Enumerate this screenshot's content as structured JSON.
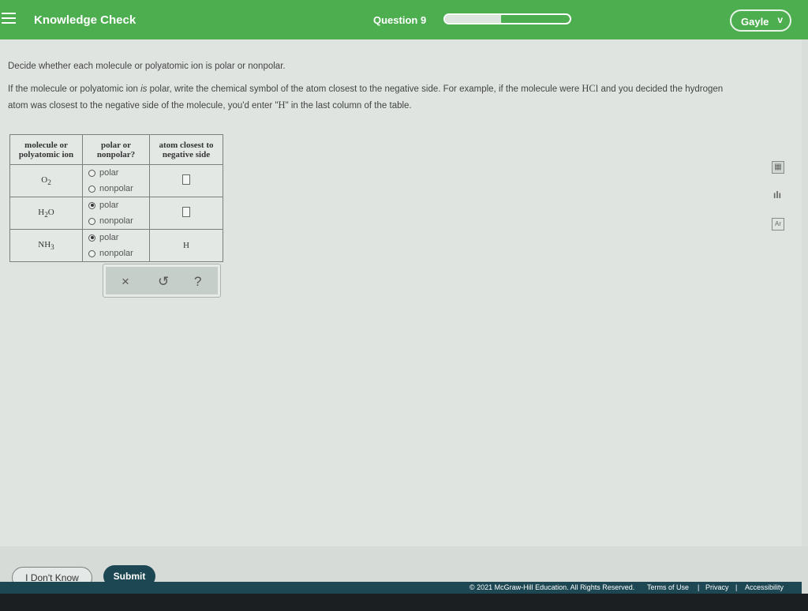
{
  "header": {
    "app_title": "Knowledge Check",
    "question_label": "Question 9",
    "progress_fraction": 0.45,
    "user_name": "Gayle",
    "user_chevron": "v"
  },
  "instructions": {
    "line1": "Decide whether each molecule or polyatomic ion is polar or nonpolar.",
    "line2_part1": "If the molecule or polyatomic ion ",
    "line2_is": "is",
    "line2_part2": " polar, write the chemical symbol of the atom closest to the negative side. For example, if the molecule were ",
    "example_molecule": "HCl",
    "line2_part3": " and you decided the hydrogen atom was closest to the negative side of the molecule, you'd enter \"",
    "example_answer": "H",
    "line2_part4": "\" in the last column of the table."
  },
  "table": {
    "headers": {
      "col1_line1": "molecule or",
      "col1_line2": "polyatomic ion",
      "col2_line1": "polar or",
      "col2_line2": "nonpolar?",
      "col3_line1": "atom closest to",
      "col3_line2": "negative side"
    },
    "rows": [
      {
        "molecule": "O",
        "sub1": "2",
        "rest": "",
        "sub2": "",
        "polar_label": "polar",
        "nonpolar_label": "nonpolar",
        "selected": "none",
        "answer": ""
      },
      {
        "molecule": "H",
        "sub1": "2",
        "rest": "O",
        "sub2": "",
        "polar_label": "polar",
        "nonpolar_label": "nonpolar",
        "selected": "polar",
        "answer": ""
      },
      {
        "molecule": "NH",
        "sub1": "3",
        "rest": "",
        "sub2": "",
        "polar_label": "polar",
        "nonpolar_label": "nonpolar",
        "selected": "polar",
        "answer": "H"
      }
    ]
  },
  "actions": {
    "clear": "×",
    "undo": "↺",
    "help": "?"
  },
  "tools": {
    "calculator_icon": "calculator-icon",
    "chart_icon": "data-chart-icon",
    "periodic_icon": "periodic-table-icon",
    "calc_glyph": "▦",
    "chart_glyph": "ılı",
    "periodic_glyph": "Ar"
  },
  "footer": {
    "dont_know": "I Don't Know",
    "submit": "Submit",
    "copyright": "© 2021 McGraw-Hill Education. All Rights Reserved.",
    "terms": "Terms of Use",
    "privacy": "Privacy",
    "accessibility": "Accessibility",
    "separator": "|"
  },
  "colors": {
    "header_green": "#4cae4f",
    "submit_navy": "#1d4752"
  }
}
